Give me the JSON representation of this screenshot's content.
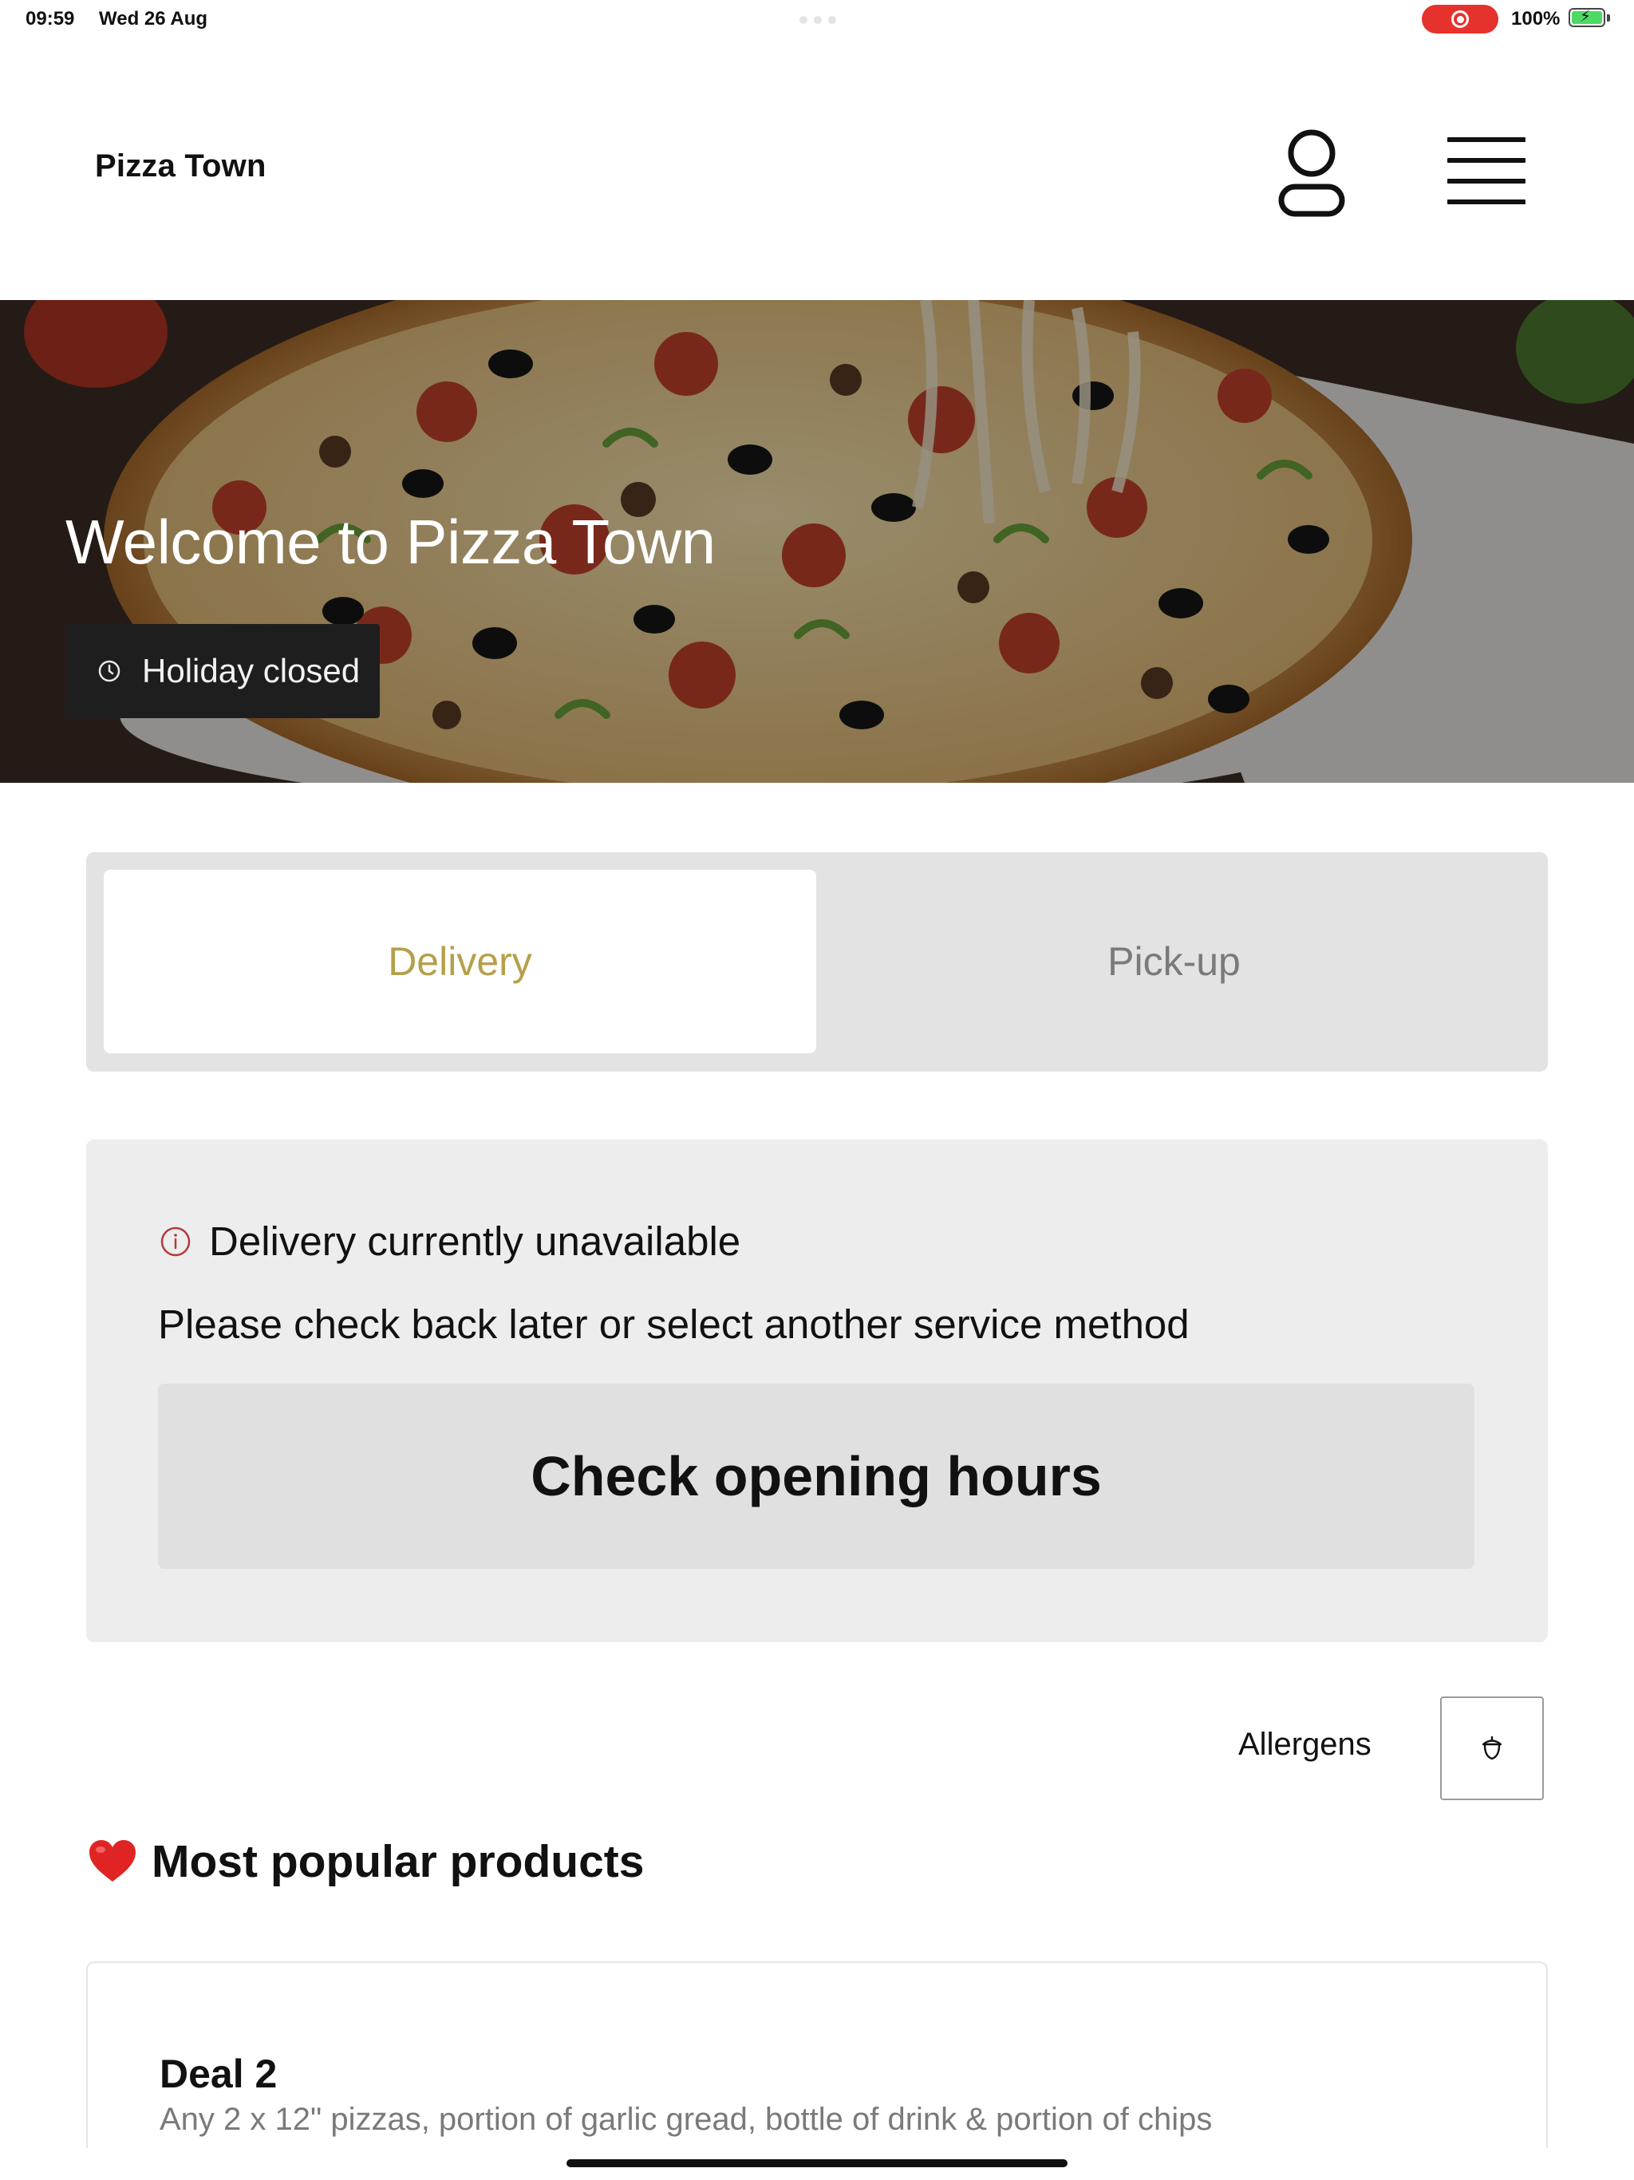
{
  "status_bar": {
    "time": "09:59",
    "date": "Wed 26 Aug",
    "battery": "100%"
  },
  "header": {
    "brand": "Pizza Town",
    "icons": [
      "user-icon",
      "hamburger-menu-icon"
    ]
  },
  "hero": {
    "title": "Welcome to Pizza Town",
    "status": "Holiday closed",
    "status_icon": "clock-icon"
  },
  "service_toggle": {
    "options": [
      "Delivery",
      "Pick-up"
    ],
    "selected": "Delivery"
  },
  "notice": {
    "icon": "info-icon",
    "title": "Delivery currently unavailable",
    "body": "Please check back later or select another service method",
    "button": "Check opening hours"
  },
  "allergens": {
    "label": "Allergens",
    "icon": "acorn-icon"
  },
  "popular": {
    "emoji": "❤️",
    "title": "Most popular products",
    "products": [
      {
        "name": "Deal 2",
        "description": "Any 2 x 12\" pizzas, portion of garlic gread, bottle of drink & portion of chips"
      }
    ]
  },
  "colors": {
    "accent_gold": "#b5a04a",
    "record_red": "#e5322d",
    "notice_bg": "#ededed",
    "toggle_bg": "#e3e3e3"
  }
}
